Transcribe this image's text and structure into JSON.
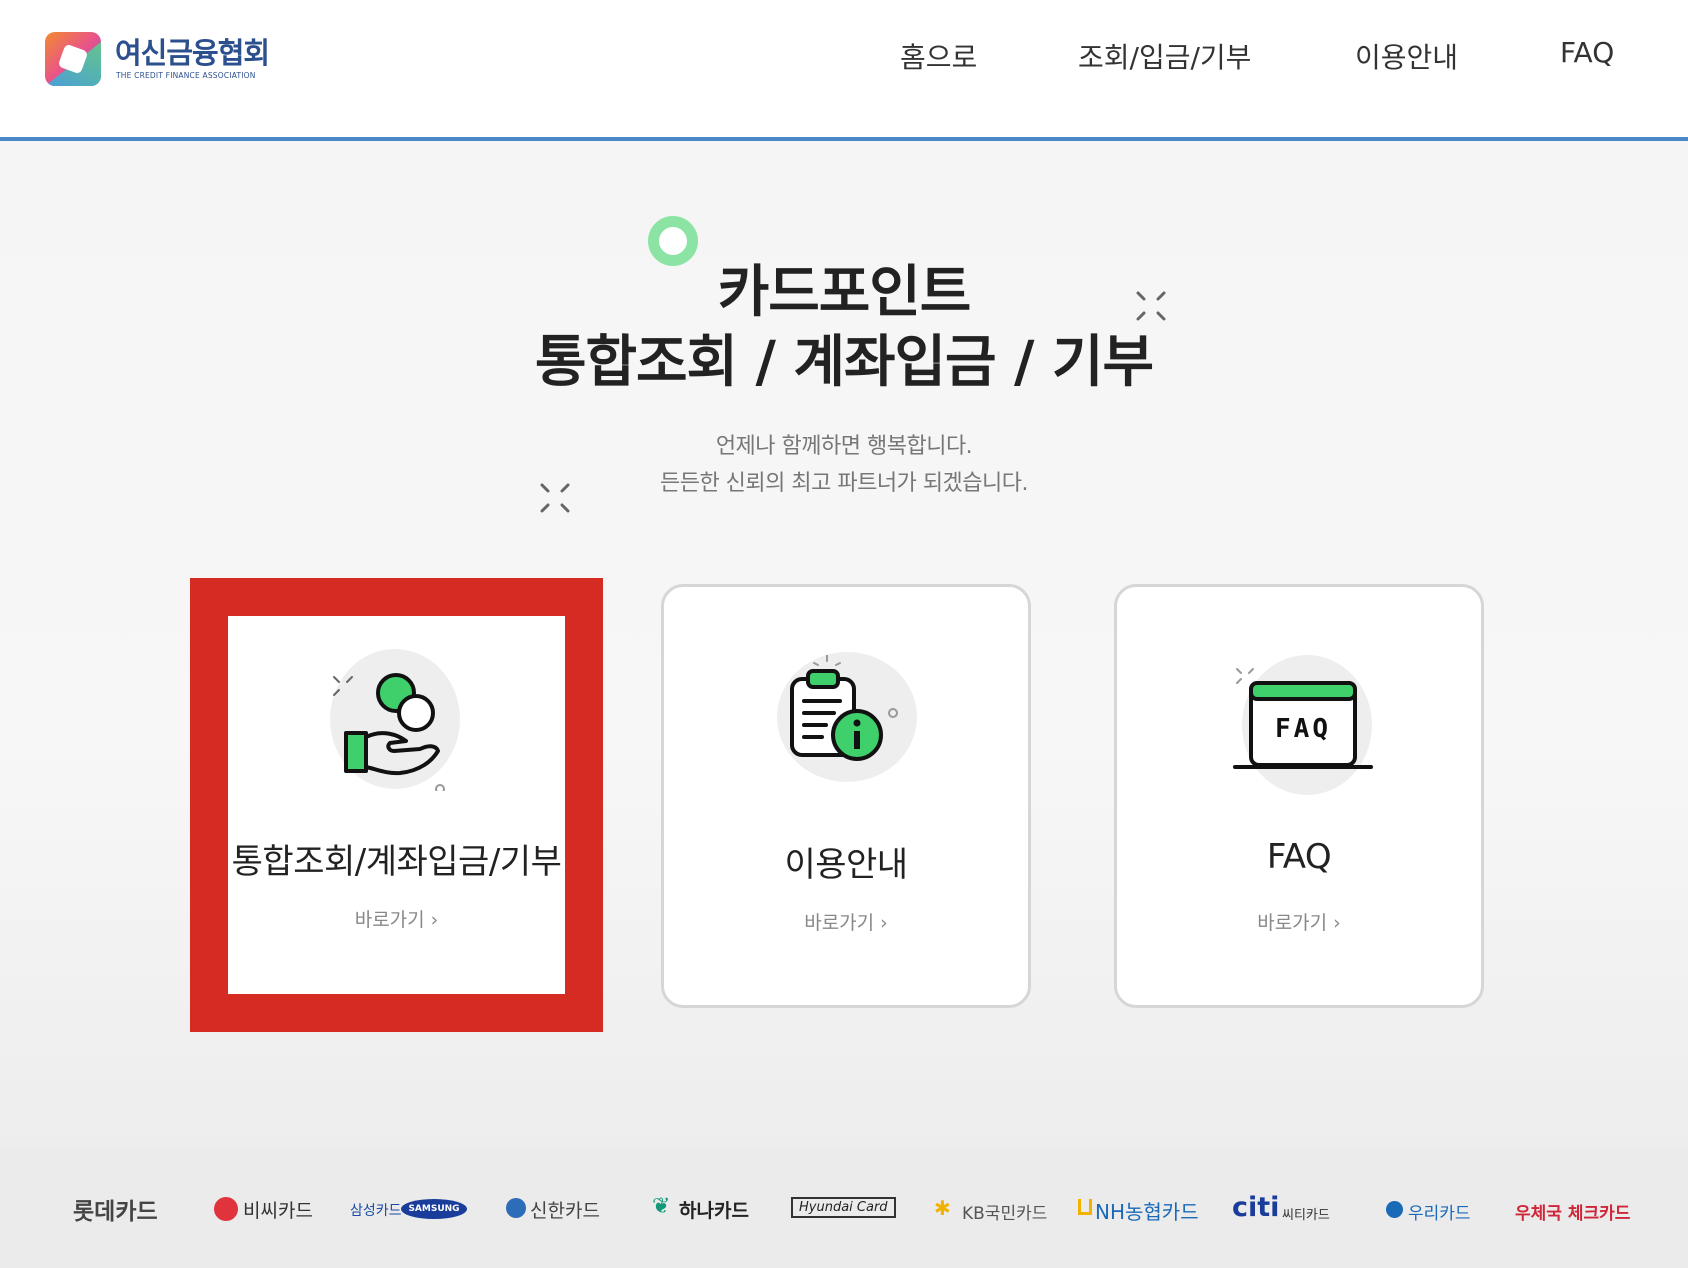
{
  "header": {
    "logo_title": "여신금융협회",
    "logo_subtitle": "THE CREDIT FINANCE ASSOCIATION",
    "nav": [
      "홈으로",
      "조회/입금/기부",
      "이용안내",
      "FAQ"
    ]
  },
  "hero": {
    "title_line1": "카드포인트",
    "title_line2": "통합조회 / 계좌입금 / 기부",
    "subtitle_line1": "언제나 함께하면 행복합니다.",
    "subtitle_line2": "든든한 신뢰의 최고 파트너가 되겠습니다."
  },
  "cards": [
    {
      "title": "통합조회/계좌입금/기부",
      "link": "바로가기",
      "icon": "coins-hand-icon"
    },
    {
      "title": "이용안내",
      "link": "바로가기",
      "icon": "clipboard-info-icon"
    },
    {
      "title": "FAQ",
      "link": "바로가기",
      "icon": "faq-board-icon",
      "icon_text": "FAQ"
    }
  ],
  "brands": [
    "롯데카드",
    "비씨카드",
    "삼성카드",
    "SAMSUNG",
    "신한카드",
    "하나카드",
    "Hyundai Card",
    "KB국민카드",
    "NH농협카드",
    "citi",
    "씨티카드",
    "우리카드",
    "우체국 체크카드"
  ],
  "colors": {
    "accent_green": "#2fbf59",
    "highlight_red": "#d62b22",
    "header_line": "#4a86c8"
  }
}
